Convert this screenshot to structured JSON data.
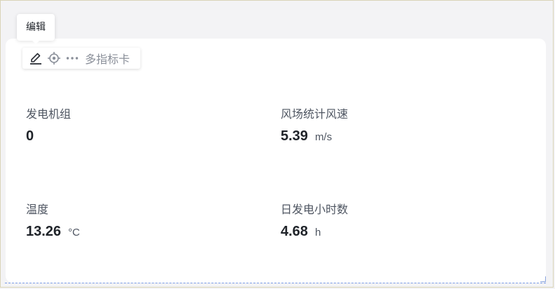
{
  "tooltip": {
    "text": "编辑"
  },
  "toolbar": {
    "title": "多指标卡",
    "icons": [
      "edit-icon",
      "locate-icon",
      "more-icon"
    ]
  },
  "metrics": [
    {
      "label": "发电机组",
      "value": "0",
      "unit": ""
    },
    {
      "label": "风场统计风速",
      "value": "5.39",
      "unit": "m/s"
    },
    {
      "label": "温度",
      "value": "13.26",
      "unit": "°C"
    },
    {
      "label": "日发电小时数",
      "value": "4.68",
      "unit": "h"
    }
  ],
  "colors": {
    "background": "#f3f3f5",
    "card": "#ffffff",
    "selection_outline": "#7a9be6",
    "text_primary": "#1f2329",
    "text_secondary": "#4e5561",
    "toolbar_muted": "#8a8f99"
  }
}
